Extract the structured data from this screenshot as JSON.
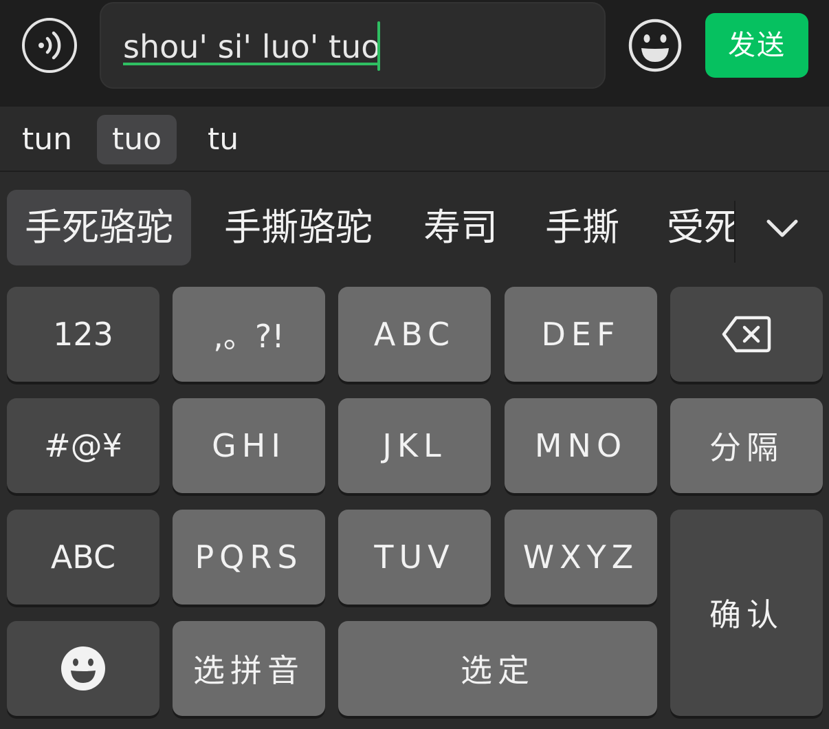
{
  "input_bar": {
    "composing_text": "shou' si' luo' tuo",
    "send_label": "发送",
    "voice_icon": "voice-icon",
    "emoji_icon": "emoji-icon",
    "accent_color": "#06c160"
  },
  "pinyin_options": [
    {
      "label": "tun",
      "selected": false
    },
    {
      "label": "tuo",
      "selected": true
    },
    {
      "label": "tu",
      "selected": false
    }
  ],
  "candidates": [
    {
      "label": "手死骆驼",
      "selected": true
    },
    {
      "label": "手撕骆驼",
      "selected": false
    },
    {
      "label": "寿司",
      "selected": false
    },
    {
      "label": "手撕",
      "selected": false
    },
    {
      "label": "受死",
      "selected": false
    }
  ],
  "candidates_expand_icon": "chevron-down-icon",
  "keyboard": {
    "row1": [
      "123",
      ",。?!",
      "ABC",
      "DEF"
    ],
    "backspace_icon": "backspace-icon",
    "row2": [
      "#@¥",
      "GHI",
      "JKL",
      "MNO",
      "分隔"
    ],
    "row3": [
      "ABC",
      "PQRS",
      "TUV",
      "WXYZ"
    ],
    "confirm": "确认",
    "row4_emoji_icon": "emoji-icon",
    "select_pinyin": "选拼音",
    "select": "选定"
  }
}
